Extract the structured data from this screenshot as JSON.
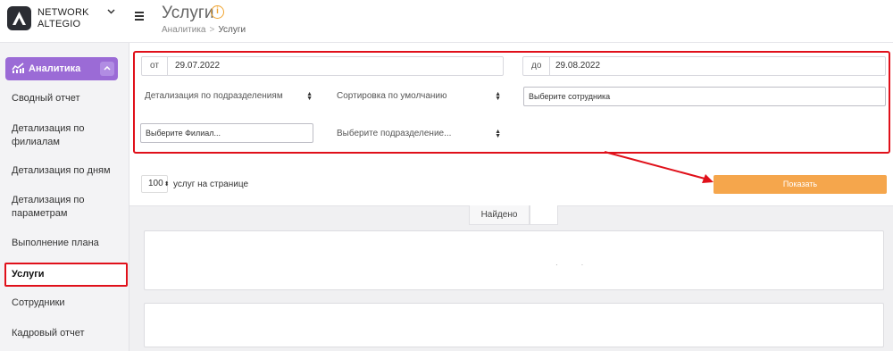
{
  "brand": {
    "line1": "NETWORK",
    "line2": "ALTEGIO"
  },
  "sidebar": {
    "section_label": "Аналитика",
    "items": [
      {
        "label": "Сводный отчет"
      },
      {
        "label": "Детализация по филиалам"
      },
      {
        "label": "Детализация по дням"
      },
      {
        "label": "Детализация по параметрам"
      },
      {
        "label": "Выполнение плана"
      },
      {
        "label": "Услуги",
        "active": true
      },
      {
        "label": "Сотрудники"
      },
      {
        "label": "Кадровый отчет"
      }
    ]
  },
  "header": {
    "title": "Услуги",
    "breadcrumb": [
      "Аналитика",
      "Услуги"
    ]
  },
  "filters": {
    "from_label": "от",
    "from_value": "29.07.2022",
    "to_label": "до",
    "to_value": "29.08.2022",
    "detail_select": "Детализация по подразделениям",
    "sort_select": "Сортировка по умолчанию",
    "employee_placeholder": "Выберите сотрудника",
    "branch_placeholder": "Выберите Филиал...",
    "division_select": "Выберите подразделение..."
  },
  "pagination": {
    "per_page": "100",
    "per_page_label": "услуг на странице"
  },
  "show_button": "Показать",
  "results": {
    "found_label": "Найдено"
  },
  "colors": {
    "accent_purple": "#9b6bd6",
    "button_orange": "#f5a64c",
    "annotation_red": "#e0101a"
  }
}
